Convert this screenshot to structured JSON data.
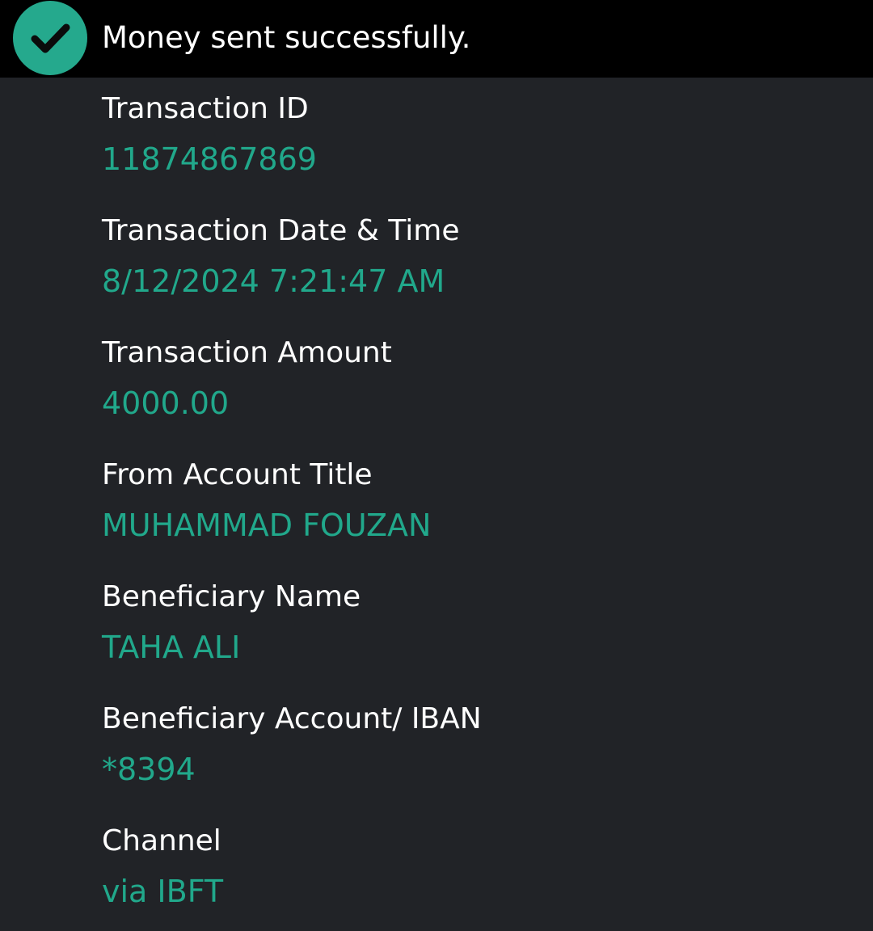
{
  "banner": {
    "icon": "checkmark-circle-icon",
    "message": "Money sent successfully.",
    "accent_color": "#25a98d"
  },
  "details": [
    {
      "label": "Transaction ID",
      "value": "11874867869"
    },
    {
      "label": "Transaction Date & Time",
      "value": "8/12/2024 7:21:47 AM"
    },
    {
      "label": "Transaction Amount",
      "value": "4000.00"
    },
    {
      "label": "From Account Title",
      "value": "MUHAMMAD FOUZAN"
    },
    {
      "label": "Beneficiary Name",
      "value": "TAHA ALI"
    },
    {
      "label": "Beneficiary Account/ IBAN",
      "value": "*8394"
    },
    {
      "label": "Channel",
      "value": "via IBFT"
    }
  ],
  "colors": {
    "background": "#212327",
    "banner_background": "#000000",
    "label_text": "#ffffff",
    "value_text": "#21a88b"
  }
}
